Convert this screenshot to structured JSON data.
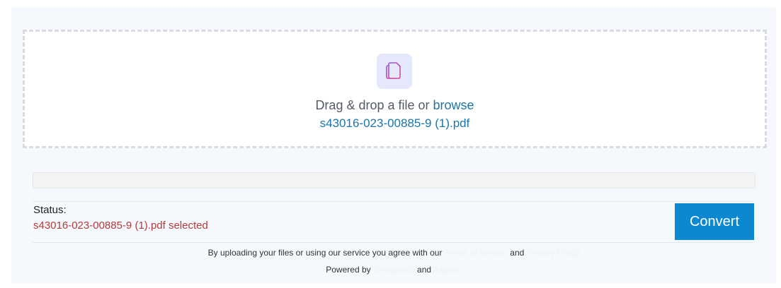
{
  "upload": {
    "drag_text": "Drag & drop a file or",
    "browse_label": "browse",
    "selected_file": "s43016-023-00885-9 (1).pdf",
    "icon": "document-stack-icon"
  },
  "progress": {
    "value": 0
  },
  "status": {
    "label": "Status:",
    "message": "s43016-023-00885-9 (1).pdf selected"
  },
  "actions": {
    "convert_label": "Convert"
  },
  "footer": {
    "terms_prefix": "By uploading your files or using our service you agree with our",
    "terms_link": "Terms of Service",
    "terms_and": "and",
    "privacy_link": "Privacy Policy",
    "powered_prefix": "Powered by",
    "powered_link_1": "Groupdocs",
    "powered_and": "and",
    "powered_link_2": "Aspose"
  },
  "colors": {
    "accent": "#0c88d1",
    "link": "#1b76a8",
    "status_message": "#b23b3b",
    "panel_bg": "#f5f8fc"
  }
}
